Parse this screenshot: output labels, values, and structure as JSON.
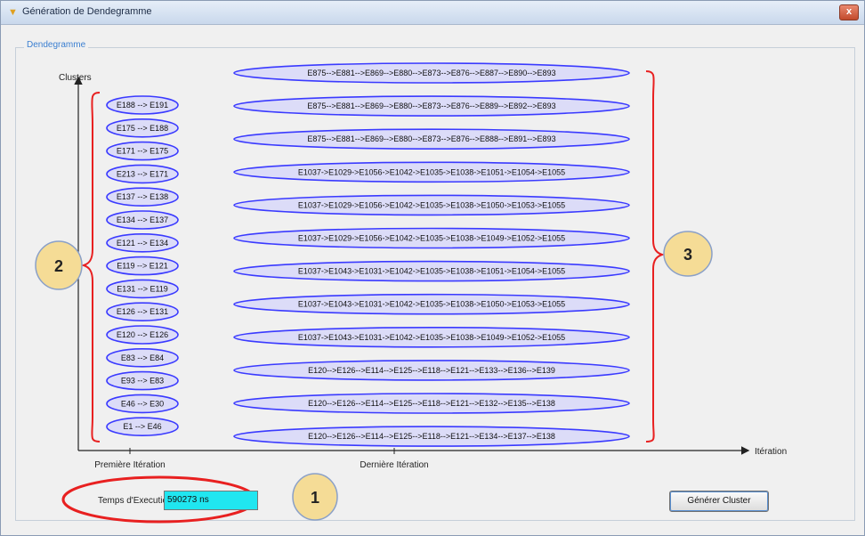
{
  "window": {
    "title": "Génération de Dendegramme",
    "close_symbol": "x",
    "title_icon": "app-icon"
  },
  "panel": {
    "title": "Dendegramme"
  },
  "axes": {
    "y_label": "Clusters",
    "x_label": "Itération",
    "x_tick_first": "Première Itération",
    "x_tick_last": "Dernière Itération"
  },
  "first_iteration": [
    "E188 --> E191",
    "E175 --> E188",
    "E171 --> E175",
    "E213 --> E171",
    "E137 --> E138",
    "E134 --> E137",
    "E121 --> E134",
    "E119 --> E121",
    "E131 --> E119",
    "E126 --> E131",
    "E120 --> E126",
    "E83 --> E84",
    "E93 --> E83",
    "E46 --> E30",
    "E1 --> E46"
  ],
  "last_iteration": [
    "E875-->E881-->E869-->E880-->E873-->E876-->E887-->E890-->E893",
    "E875-->E881-->E869-->E880-->E873-->E876-->E889-->E892-->E893",
    "E875-->E881-->E869-->E880-->E873-->E876-->E888-->E891-->E893",
    "E1037->E1029->E1056->E1042->E1035->E1038->E1051->E1054->E1055",
    "E1037->E1029->E1056->E1042->E1035->E1038->E1050->E1053->E1055",
    "E1037->E1029->E1056->E1042->E1035->E1038->E1049->E1052->E1055",
    "E1037->E1043->E1031->E1042->E1035->E1038->E1051->E1054->E1055",
    "E1037->E1043->E1031->E1042->E1035->E1038->E1050->E1053->E1055",
    "E1037->E1043->E1031->E1042->E1035->E1038->E1049->E1052->E1055",
    "E120-->E126-->E114-->E125-->E118-->E121-->E133-->E136-->E139",
    "E120-->E126-->E114-->E125-->E118-->E121-->E132-->E135-->E138",
    "E120-->E126-->E114-->E125-->E118-->E121-->E134-->E137-->E138"
  ],
  "badges": [
    "1",
    "2",
    "3"
  ],
  "execution": {
    "label": "Temps d'Execution",
    "value": "590273 ns"
  },
  "generate_button": {
    "label": "Générer Cluster"
  },
  "colors": {
    "ellipse_stroke": "#3a3aff",
    "ellipse_fill": "#dcdcf8",
    "brace": "#e82020",
    "badge_fill": "#f5dc96",
    "badge_stroke": "#8aa0c8",
    "highlight": "#e82020",
    "field_bg": "#20e6f0"
  }
}
